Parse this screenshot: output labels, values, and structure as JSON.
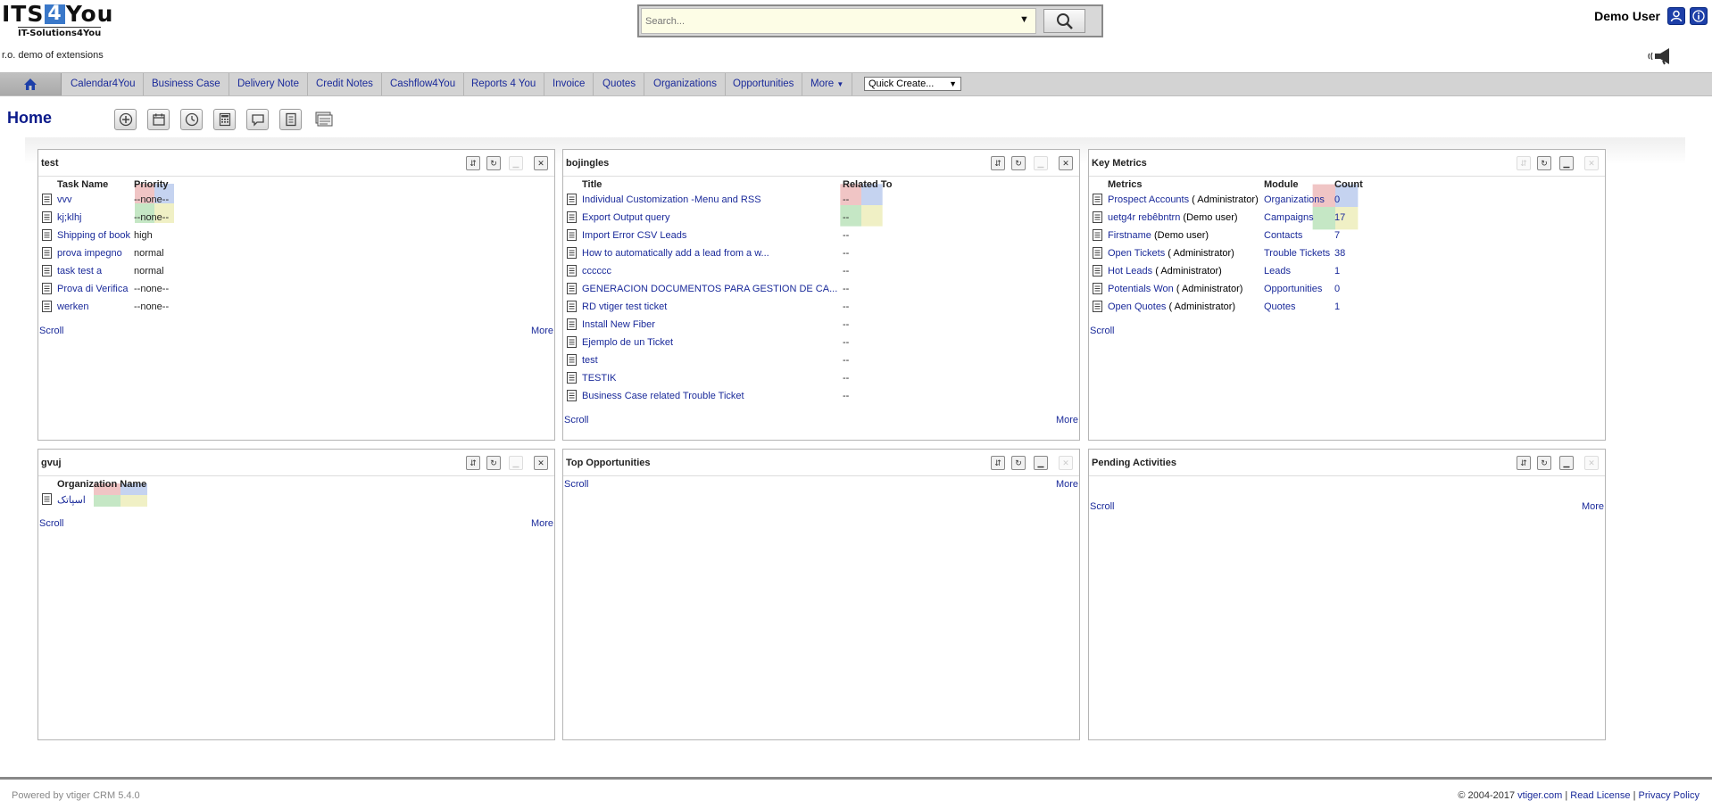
{
  "header": {
    "logo_main_a": "ITS",
    "logo_num": "4",
    "logo_main_b": "You",
    "logo_sub": "IT-Solutions4You",
    "tagline": "r.o. demo of extensions",
    "search_placeholder": "Search...",
    "user_name": "Demo User"
  },
  "nav": {
    "tabs": [
      "Calendar4You",
      "Business Case",
      "Delivery Note",
      "Credit Notes",
      "Cashflow4You",
      "Reports 4 You",
      "Invoice",
      "Quotes",
      "Organizations",
      "Opportunities"
    ],
    "more_label": "More",
    "quick_create": "Quick Create..."
  },
  "page": {
    "title": "Home"
  },
  "widgets": {
    "test": {
      "title": "test",
      "columns": [
        "Task Name",
        "Priority"
      ],
      "rows": [
        [
          "vvv",
          "--none--"
        ],
        [
          "kj;klhj",
          "--none--"
        ],
        [
          "Shipping of book",
          "high"
        ],
        [
          "prova impegno",
          "normal"
        ],
        [
          "task test a",
          "normal"
        ],
        [
          "Prova di Verifica",
          "--none--"
        ],
        [
          "werken",
          "--none--"
        ]
      ],
      "scroll": "Scroll",
      "more": "More"
    },
    "bojingles": {
      "title": "bojingles",
      "columns": [
        "Title",
        "Related To"
      ],
      "rows": [
        [
          "Individual Customization -Menu and RSS",
          "--"
        ],
        [
          "Export Output query",
          "--"
        ],
        [
          "Import Error CSV Leads",
          "--"
        ],
        [
          "How to automatically add a lead from a w...",
          "--"
        ],
        [
          "cccccc",
          "--"
        ],
        [
          "GENERACION DOCUMENTOS PARA GESTION DE CA...",
          "--"
        ],
        [
          "RD vtiger test ticket",
          "--"
        ],
        [
          "Install New Fiber",
          "--"
        ],
        [
          "Ejemplo de un Ticket",
          "--"
        ],
        [
          "test",
          "--"
        ],
        [
          "TESTIK",
          "--"
        ],
        [
          "Business Case related Trouble Ticket",
          "--"
        ]
      ],
      "scroll": "Scroll",
      "more": "More"
    },
    "key_metrics": {
      "title": "Key Metrics",
      "columns": [
        "Metrics",
        "Module",
        "Count"
      ],
      "rows": [
        [
          "Prospect Accounts",
          "( Administrator)",
          "Organizations",
          "0"
        ],
        [
          "uetg4r rebêbntrn",
          "(Demo user)",
          "Campaigns",
          "17"
        ],
        [
          "Firstname",
          "(Demo user)",
          "Contacts",
          "7"
        ],
        [
          "Open Tickets",
          "( Administrator)",
          "Trouble Tickets",
          "38"
        ],
        [
          "Hot Leads",
          "( Administrator)",
          "Leads",
          "1"
        ],
        [
          "Potentials Won",
          "( Administrator)",
          "Opportunities",
          "0"
        ],
        [
          "Open Quotes",
          "( Administrator)",
          "Quotes",
          "1"
        ]
      ],
      "scroll": "Scroll"
    },
    "gvuj": {
      "title": "gvuj",
      "columns": [
        "Organization Name"
      ],
      "rows": [
        [
          "اسپاتک"
        ]
      ],
      "scroll": "Scroll",
      "more": "More"
    },
    "top_opportunities": {
      "title": "Top Opportunities",
      "scroll": "Scroll",
      "more": "More"
    },
    "pending_activities": {
      "title": "Pending Activities",
      "scroll": "Scroll",
      "more": "More"
    }
  },
  "footer": {
    "powered": "Powered by vtiger CRM 5.4.0",
    "copyright": "© 2004-2017",
    "vtiger_link": "vtiger.com",
    "sep": "|",
    "read_license": "Read License",
    "privacy": "Privacy Policy"
  },
  "colors": {
    "link": "#1a2a9a",
    "title": "#0b1a8a",
    "navbar": "#d3d3d3",
    "search_bg": "#fdfde6"
  }
}
